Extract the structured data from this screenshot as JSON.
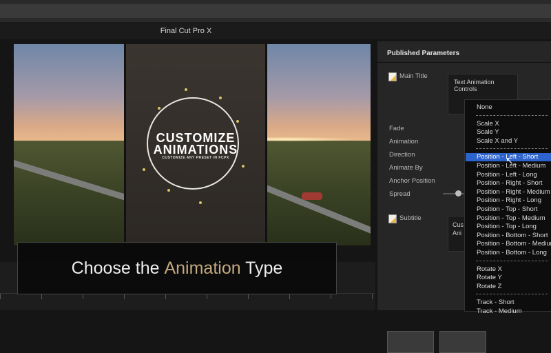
{
  "app": {
    "title": "Final Cut Pro X"
  },
  "preview": {
    "headline_line1": "CUSTOMIZE",
    "headline_line2": "ANIMATIONS",
    "subline": "CUSTOMIZE ANY PRESET IN FCPX"
  },
  "caption": {
    "part1": "Choose the ",
    "accent": "Animation",
    "part2": " Type"
  },
  "inspector": {
    "header": "Published Parameters",
    "main_title": "Main Title",
    "text_animation_controls": "Text Animation Controls",
    "params": [
      "Fade",
      "Animation",
      "Direction",
      "Animate By",
      "Anchor Position",
      "Spread"
    ],
    "subtitle": "Subtitle",
    "subtitle_box_line1": "Cus",
    "subtitle_box_line2": "Ani"
  },
  "menu": {
    "selected": "Position - Left - Short",
    "items": [
      "None",
      "Scale X",
      "Scale Y",
      "Scale X and Y",
      "Position - Left - Short",
      "Position - Left - Medium",
      "Position - Left - Long",
      "Position - Right - Short",
      "Position - Right - Medium",
      "Position - Right - Long",
      "Position - Top - Short",
      "Position - Top - Medium",
      "Position - Top - Long",
      "Position - Bottom - Short",
      "Position - Bottom - Medium",
      "Position - Bottom - Long",
      "Rotate X",
      "Rotate Y",
      "Rotate Z",
      "Track - Short",
      "Track - Medium"
    ]
  },
  "colors": {
    "accent": "#c4a97f",
    "selection": "#2d63cc"
  }
}
